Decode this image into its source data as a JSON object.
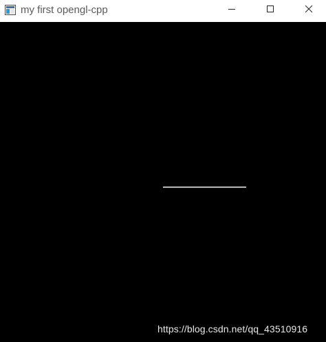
{
  "window": {
    "title": "my first opengl-cpp",
    "background_color": "#ffffff",
    "title_color": "#5a5a5a"
  },
  "titlebar": {
    "app_icon": "opengl-window-app-icon",
    "minimize_icon": "minimize-icon",
    "maximize_icon": "maximize-icon",
    "close_icon": "close-icon"
  },
  "canvas": {
    "background_color": "#000000",
    "line_color": "#ffffff"
  },
  "watermark": {
    "text": "https://blog.csdn.net/qq_43510916"
  }
}
